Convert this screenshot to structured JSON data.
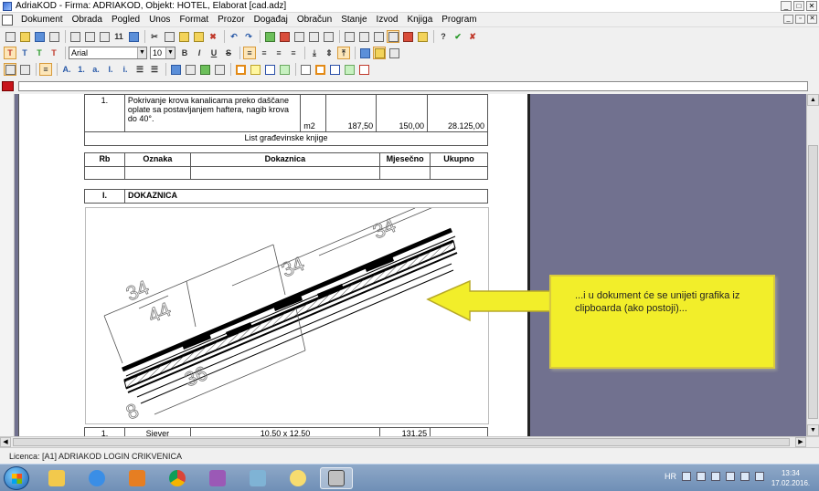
{
  "window": {
    "title": "AdriaKOD - Firma: ADRIAKOD,   Objekt: HOTEL, Elaborat [cad.adz]"
  },
  "menu": {
    "items": [
      "Dokument",
      "Obrada",
      "Pogled",
      "Unos",
      "Format",
      "Prozor",
      "Događaj",
      "Obračun",
      "Stanje",
      "Izvod",
      "Knjiga",
      "Program"
    ]
  },
  "format_toolbar": {
    "font_name": "Arial",
    "font_size": "10",
    "bold": "B",
    "italic": "I",
    "underline": "U",
    "strike": "S"
  },
  "document": {
    "row1": {
      "rb": "1.",
      "description": "Pokrivanje krova kanalicama preko daščane oplate sa postavljanjem haftera, nagib krova do 40°.",
      "unit": "m2",
      "qty": "187,50",
      "price": "150,00",
      "total": "28.125,00"
    },
    "sheet_title": "List građevinske knjige",
    "headers": {
      "rb": "Rb",
      "oznaka": "Oznaka",
      "dokaznica": "Dokaznica",
      "mjesecno": "Mjesečno",
      "ukupno": "Ukupno"
    },
    "section": {
      "rb": "I.",
      "label": "DOKAZNICA"
    },
    "bottom_row": {
      "rb": "1.",
      "oznaka": "Sjever",
      "dokaznica": "10,50 x 12,50",
      "mjesecno": "131,25"
    }
  },
  "drawing": {
    "dims": [
      "34",
      "44",
      "34",
      "34",
      "36",
      "8"
    ]
  },
  "callout": {
    "text": "...i u dokument će se unijeti grafika iz clipboarda (ako postoji)..."
  },
  "status": {
    "license": "Licenca:  [A1] ADRIAKOD LOGIN CRIKVENICA"
  },
  "taskbar": {
    "language": "HR",
    "time": "13:34",
    "date": "17.02.2016."
  },
  "colors": {
    "workspace": "#71718f",
    "callout_bg": "#f2ee2a",
    "arrow": "#f2ee2a"
  }
}
